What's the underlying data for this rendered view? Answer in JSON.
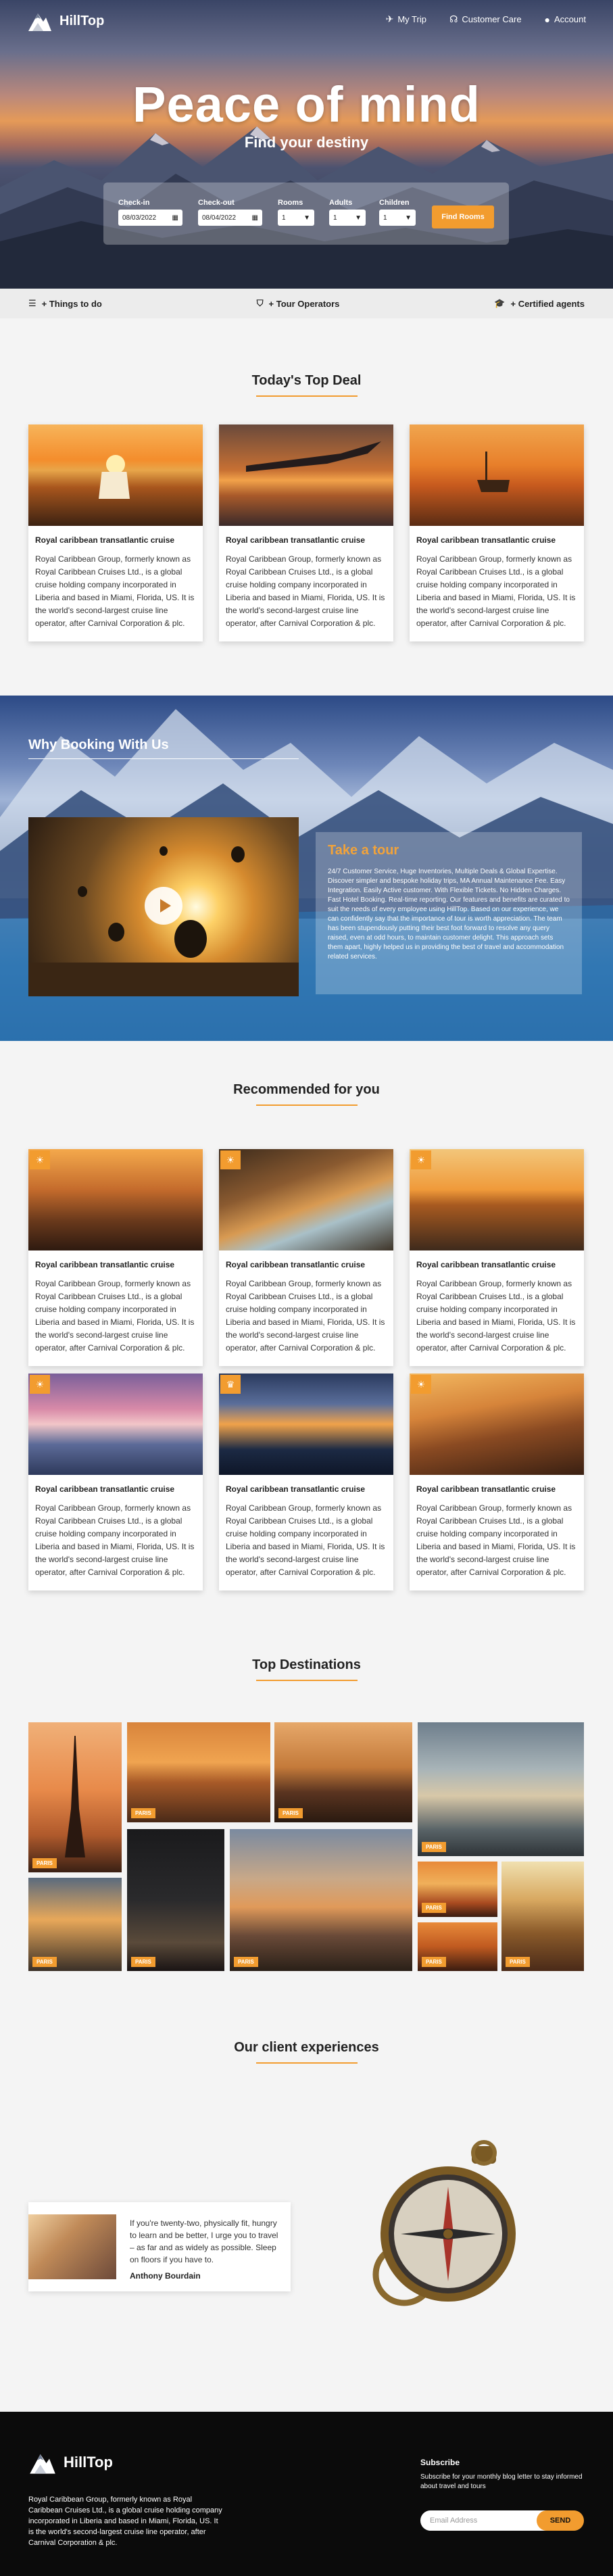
{
  "brand": {
    "name": "HillTop"
  },
  "nav": {
    "my_trip": "My Trip",
    "customer_care": "Customer Care",
    "account": "Account"
  },
  "hero": {
    "title": "Peace of mind",
    "subtitle": "Find your destiny"
  },
  "search": {
    "checkin_label": "Check-in",
    "checkin_value": "08/03/2022",
    "checkout_label": "Check-out",
    "checkout_value": "08/04/2022",
    "rooms_label": "Rooms",
    "rooms_value": "1",
    "adults_label": "Adults",
    "adults_value": "1",
    "children_label": "Children",
    "children_value": "1",
    "find_label": "Find Rooms"
  },
  "features": {
    "things": "+ Things to do",
    "operators": "+ Tour Operators",
    "agents": "+ Certified agents"
  },
  "top_deal": {
    "title": "Today's Top Deal",
    "cards": [
      {
        "title": "Royal caribbean transatlantic cruise",
        "text": "Royal Caribbean Group, formerly known as Royal Caribbean Cruises Ltd., is a global cruise holding company incorporated in Liberia and based in Miami, Florida, US. It is the world's second-largest cruise line operator, after Carnival Corporation & plc."
      },
      {
        "title": "Royal caribbean transatlantic cruise",
        "text": "Royal Caribbean Group, formerly known as Royal Caribbean Cruises Ltd., is a global cruise holding company incorporated in Liberia and based in Miami, Florida, US. It is the world's second-largest cruise line operator, after Carnival Corporation & plc."
      },
      {
        "title": "Royal caribbean transatlantic cruise",
        "text": "Royal Caribbean Group, formerly known as Royal Caribbean Cruises Ltd., is a global cruise holding company incorporated in Liberia and based in Miami, Florida, US. It is the world's second-largest cruise line operator, after Carnival Corporation & plc."
      }
    ]
  },
  "why": {
    "title": "Why Booking With Us",
    "tour_title": "Take a tour",
    "tour_text": "24/7 Customer Service, Huge Inventories, Multiple Deals & Global Expertise. Discover simpler and bespoke holiday trips, MA Annual Maintenance Fee. Easy Integration. Easily Active customer. With Flexible Tickets. No Hidden Charges. Fast Hotel Booking. Real-time reporting. Our features and benefits are curated to suit the needs of every employee using HillTop. Based on our experience, we can confidently say that the importance of tour is worth appreciation. The team has been stupendously putting their best foot forward to resolve any query raised, even at odd hours, to maintain customer delight. This approach sets them apart, highly helped us in providing the best of travel and accommodation related services."
  },
  "recommended": {
    "title": "Recommended for you",
    "cards": [
      {
        "title": "Royal caribbean transatlantic cruise",
        "text": "Royal Caribbean Group, formerly known as Royal Caribbean Cruises Ltd., is a global cruise holding company incorporated in Liberia and based in Miami, Florida, US. It is the world's second-largest cruise line operator, after Carnival Corporation & plc."
      },
      {
        "title": "Royal caribbean transatlantic cruise",
        "text": "Royal Caribbean Group, formerly known as Royal Caribbean Cruises Ltd., is a global cruise holding company incorporated in Liberia and based in Miami, Florida, US. It is the world's second-largest cruise line operator, after Carnival Corporation & plc."
      },
      {
        "title": "Royal caribbean transatlantic cruise",
        "text": "Royal Caribbean Group, formerly known as Royal Caribbean Cruises Ltd., is a global cruise holding company incorporated in Liberia and based in Miami, Florida, US. It is the world's second-largest cruise line operator, after Carnival Corporation & plc."
      },
      {
        "title": "Royal caribbean transatlantic cruise",
        "text": "Royal Caribbean Group, formerly known as Royal Caribbean Cruises Ltd., is a global cruise holding company incorporated in Liberia and based in Miami, Florida, US. It is the world's second-largest cruise line operator, after Carnival Corporation & plc."
      },
      {
        "title": "Royal caribbean transatlantic cruise",
        "text": "Royal Caribbean Group, formerly known as Royal Caribbean Cruises Ltd., is a global cruise holding company incorporated in Liberia and based in Miami, Florida, US. It is the world's second-largest cruise line operator, after Carnival Corporation & plc."
      },
      {
        "title": "Royal caribbean transatlantic cruise",
        "text": "Royal Caribbean Group, formerly known as Royal Caribbean Cruises Ltd., is a global cruise holding company incorporated in Liberia and based in Miami, Florida, US. It is the world's second-largest cruise line operator, after Carnival Corporation & plc."
      }
    ]
  },
  "destinations": {
    "title": "Top Destinations",
    "tag": "PARIS"
  },
  "testimonial": {
    "title": "Our client experiences",
    "quote": "If you're twenty-two, physically fit, hungry to learn and be better, I urge you to travel – as far and as widely as possible. Sleep on floors if you have to.",
    "author": "Anthony Bourdain"
  },
  "footer": {
    "brand": "HillTop",
    "desc": "Royal Caribbean Group, formerly known as Royal Caribbean Cruises Ltd., is a global cruise holding company incorporated in Liberia and based in Miami, Florida, US. It is the world's second-largest cruise line operator, after Carnival Corporation & plc.",
    "subscribe_title": "Subscribe",
    "subscribe_text": "Subscribe for your monthly blog letter to stay informed about travel and tours",
    "email_placeholder": "Email Address",
    "send_label": "SEND"
  },
  "colors": {
    "accent": "#f29c2f",
    "footer_bg": "#0b0b0b"
  }
}
